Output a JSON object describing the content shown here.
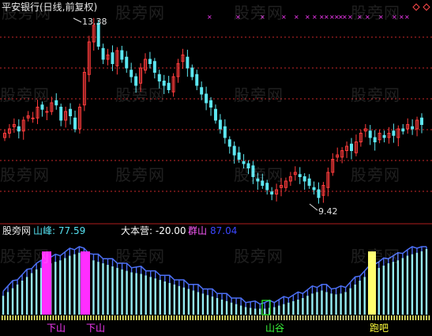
{
  "window": {
    "title": "平安银行(日线,前复权)"
  },
  "price_panel": {
    "high_label": "13.38",
    "low_label": "9.42"
  },
  "indicator_panel": {
    "name": "股旁网",
    "peak": "山峰: 77.59",
    "dabenying": "大本营: -20.00",
    "qunshan_label": "群山",
    "qunshan_value": "87.04",
    "signals": {
      "down1": "下山",
      "down2": "下山",
      "valley": "山谷",
      "run": "跑吧"
    }
  },
  "watermark": {
    "text": "股旁网"
  },
  "colors": {
    "background": "#000000",
    "candle_up": "#ff3c3c",
    "candle_down": "#5ce6f0",
    "grid": "#c8282a",
    "bar_blue": "#4c6ff5",
    "bar_cyan": "#96eef5",
    "signal_magenta": "#ff2dff",
    "signal_green": "#2cff2c",
    "signal_yellow": "#ffff6e",
    "mark_magenta": "#ff3cff"
  },
  "chart_data": {
    "type": "candlestick",
    "title": "平安银行(日线,前复权)",
    "high": 13.38,
    "low": 9.42,
    "closes": [
      10.9,
      11.0,
      11.1,
      10.95,
      11.2,
      11.3,
      11.25,
      11.5,
      11.45,
      11.4,
      11.6,
      11.55,
      11.2,
      11.4,
      11.3,
      11.0,
      11.5,
      12.3,
      13.0,
      13.38,
      12.9,
      12.6,
      12.7,
      12.5,
      12.8,
      12.6,
      12.4,
      12.2,
      12.0,
      12.4,
      12.6,
      12.5,
      12.3,
      12.1,
      12.0,
      11.9,
      12.2,
      12.5,
      12.7,
      12.4,
      12.2,
      12.0,
      11.8,
      11.6,
      11.5,
      11.2,
      11.0,
      10.8,
      10.6,
      10.4,
      10.3,
      10.2,
      10.1,
      9.9,
      9.8,
      9.7,
      9.6,
      9.5,
      9.6,
      9.7,
      9.8,
      9.9,
      10.0,
      9.9,
      9.8,
      9.7,
      9.6,
      9.42,
      9.7,
      10.0,
      10.3,
      10.4,
      10.5,
      10.6,
      10.5,
      10.7,
      10.9,
      11.0,
      10.8,
      10.7,
      10.9,
      10.8,
      10.9,
      10.85,
      11.0,
      10.95,
      11.1,
      11.0,
      11.2,
      11.1
    ],
    "indicator": {
      "peak": 77.59,
      "dabenying": -20.0,
      "qunshan": 87.04,
      "bars": [
        25,
        30,
        35,
        40,
        45,
        50,
        55,
        60,
        62,
        65,
        68,
        70,
        72,
        75,
        78,
        80,
        82,
        78,
        75,
        72,
        70,
        68,
        66,
        64,
        62,
        60,
        58,
        56,
        55,
        54,
        52,
        50,
        48,
        46,
        44,
        42,
        40,
        38,
        36,
        34,
        32,
        30,
        28,
        26,
        24,
        22,
        20,
        18,
        16,
        14,
        12,
        10,
        9,
        8,
        8,
        8,
        9,
        10,
        12,
        14,
        16,
        18,
        20,
        22,
        25,
        28,
        30,
        32,
        30,
        28,
        27,
        28,
        30,
        35,
        40,
        45,
        50,
        55,
        60,
        62,
        65,
        68,
        70,
        72,
        75,
        78,
        80,
        82,
        84,
        87
      ]
    },
    "signals": [
      {
        "label": "下山",
        "index": 15
      },
      {
        "label": "下山",
        "index": 27
      },
      {
        "label": "山谷",
        "index": 82
      },
      {
        "label": "跑吧",
        "index": 117
      }
    ]
  }
}
